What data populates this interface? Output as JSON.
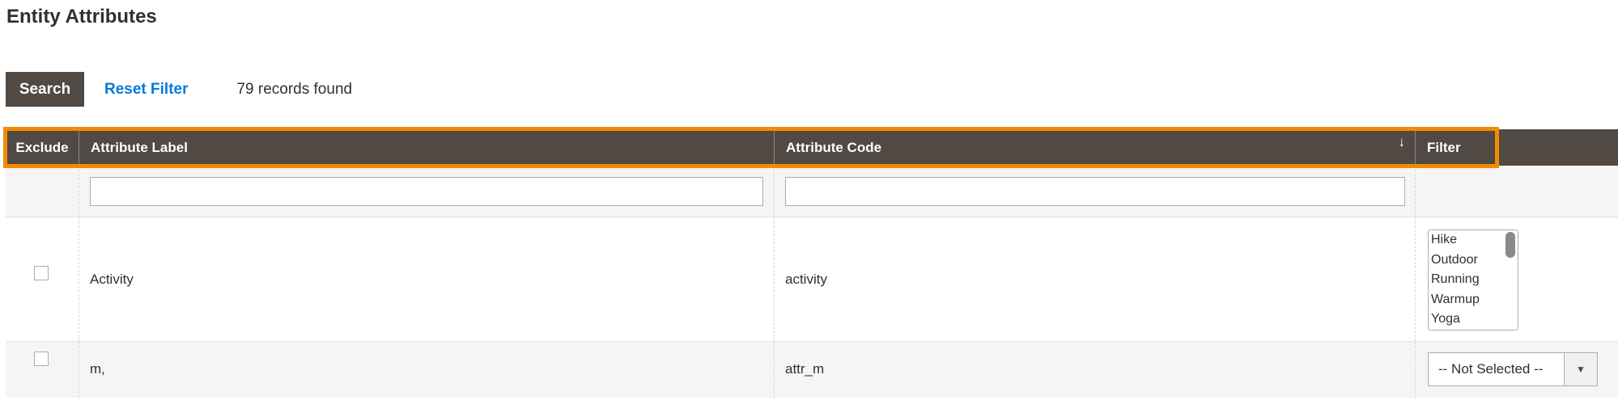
{
  "page": {
    "title": "Entity Attributes"
  },
  "toolbar": {
    "search_label": "Search",
    "reset_label": "Reset Filter",
    "records_text": "79 records found"
  },
  "columns": {
    "exclude": "Exclude",
    "label": "Attribute Label",
    "code": "Attribute Code",
    "filter": "Filter",
    "sort_indicator": "↓"
  },
  "filters": {
    "label_value": "",
    "code_value": ""
  },
  "rows": [
    {
      "label": "Activity",
      "code": "activity",
      "filter_options": [
        "Hike",
        "Outdoor",
        "Running",
        "Warmup",
        "Yoga"
      ]
    },
    {
      "label": "m,",
      "code": "attr_m",
      "filter_select": "-- Not Selected --"
    }
  ],
  "colors": {
    "header_bg": "#514943",
    "highlight": "#f38a00",
    "link": "#007bdb"
  }
}
